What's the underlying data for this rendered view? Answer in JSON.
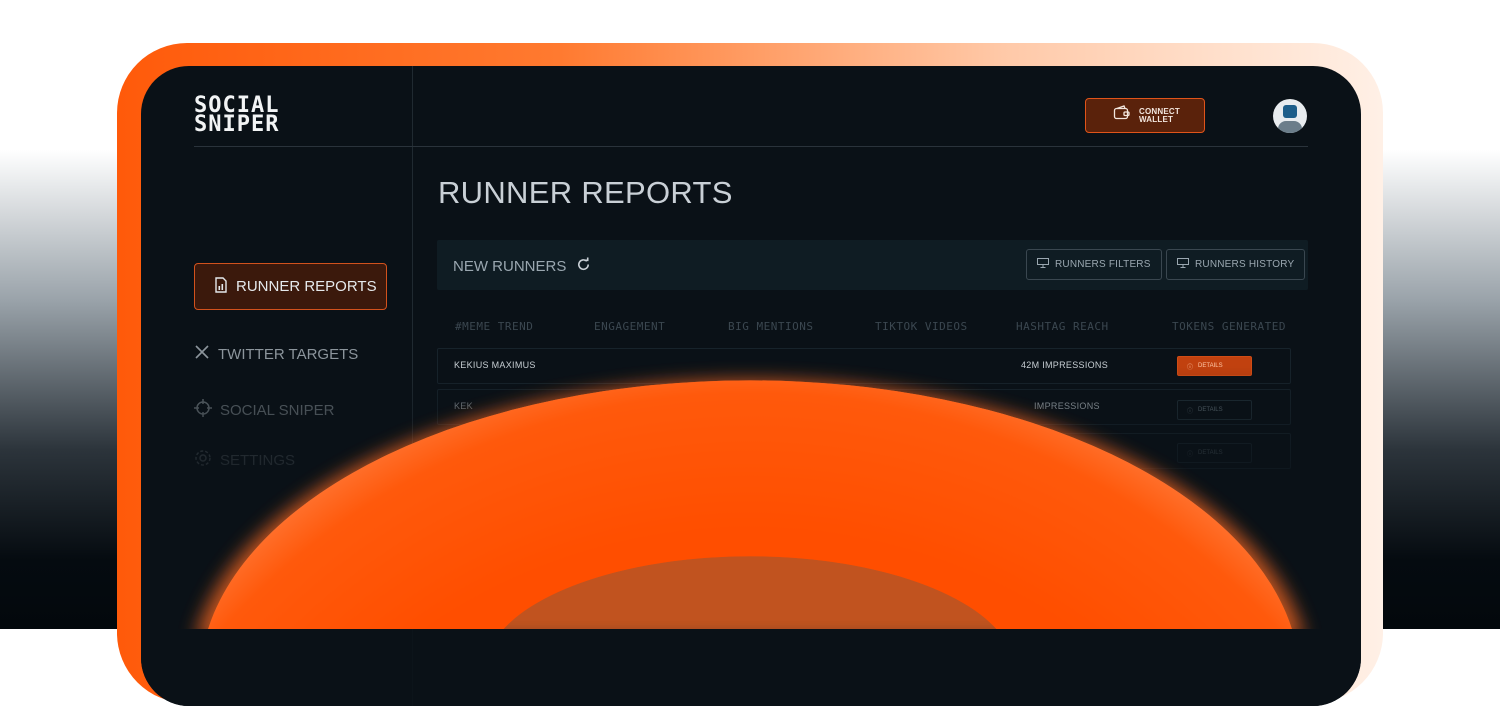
{
  "app": {
    "logo_line1": "SOCIAL",
    "logo_line2": "SNIPER"
  },
  "header": {
    "connect_wallet": "CONNECT WALLET"
  },
  "page": {
    "title": "RUNNER REPORTS"
  },
  "sidebar": {
    "items": [
      {
        "label": "RUNNER REPORTS",
        "icon": "report-icon",
        "active": true
      },
      {
        "label": "TWITTER TARGETS",
        "icon": "x-icon"
      },
      {
        "label": "SOCIAL SNIPER",
        "icon": "crosshair-icon"
      },
      {
        "label": "SETTINGS",
        "icon": "gear-icon"
      }
    ]
  },
  "panel": {
    "title": "NEW RUNNERS",
    "filters_button": "RUNNERS FILTERS",
    "history_button": "RUNNERS HISTORY"
  },
  "table": {
    "columns": [
      "#MEME TREND",
      "ENGAGEMENT",
      "BIG MENTIONS",
      "TIKTOK VIDEOS",
      "HASHTAG REACH",
      "TOKENS GENERATED"
    ],
    "rows": [
      {
        "trend": "KEKIUS MAXIMUS",
        "reach": "42M IMPRESSIONS",
        "action": "DETAILS"
      },
      {
        "trend": "KEK",
        "reach": "IMPRESSIONS",
        "action": "DETAILS"
      },
      {
        "trend": "",
        "reach": "",
        "action": "DETAILS"
      }
    ]
  },
  "colors": {
    "accent": "#ff5a0a",
    "background": "#0a1117",
    "text": "#c9d0d6"
  }
}
